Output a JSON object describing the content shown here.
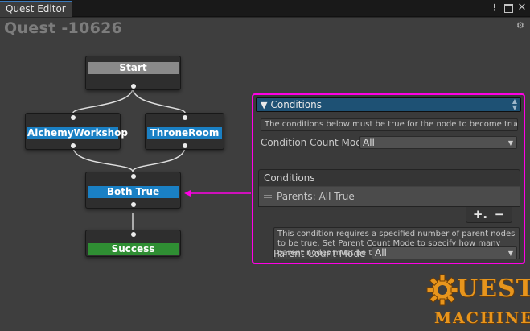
{
  "window": {
    "tab_label": "Quest Editor",
    "icons": [
      "kebab-menu-icon",
      "maximize-icon",
      "close-icon"
    ]
  },
  "canvas": {
    "quest_title": "Quest -10626",
    "settings_icon": "gear-icon"
  },
  "nodes": {
    "start": {
      "label": "Start",
      "color": "#8a8a8a"
    },
    "alchemy": {
      "label": "AlchemyWorkshop",
      "color": "#1a80c4"
    },
    "throne": {
      "label": "ThroneRoom",
      "color": "#1a80c4"
    },
    "bothtrue": {
      "label": "Both True",
      "color": "#1a80c4"
    },
    "success": {
      "label": "Success",
      "color": "#2f8e33"
    }
  },
  "panel": {
    "header": "Conditions",
    "help": "The conditions below must be true for the node to become true.",
    "count_mode_label": "Condition Count Mod",
    "count_mode_value": "All",
    "list_title": "Conditions",
    "list_items": [
      "Parents: All True"
    ],
    "add_label": "+.",
    "remove_label": "−",
    "description": "This condition requires a specified number of parent nodes to be true. Set Parent Count Mode to specify how many parent nodes must be true.",
    "parent_mode_label": "Parent Count Mode",
    "parent_mode_value": "All",
    "highlight_color": "#ff00e6"
  },
  "logo": {
    "top": "UEST",
    "bottom": "MACHINE"
  }
}
